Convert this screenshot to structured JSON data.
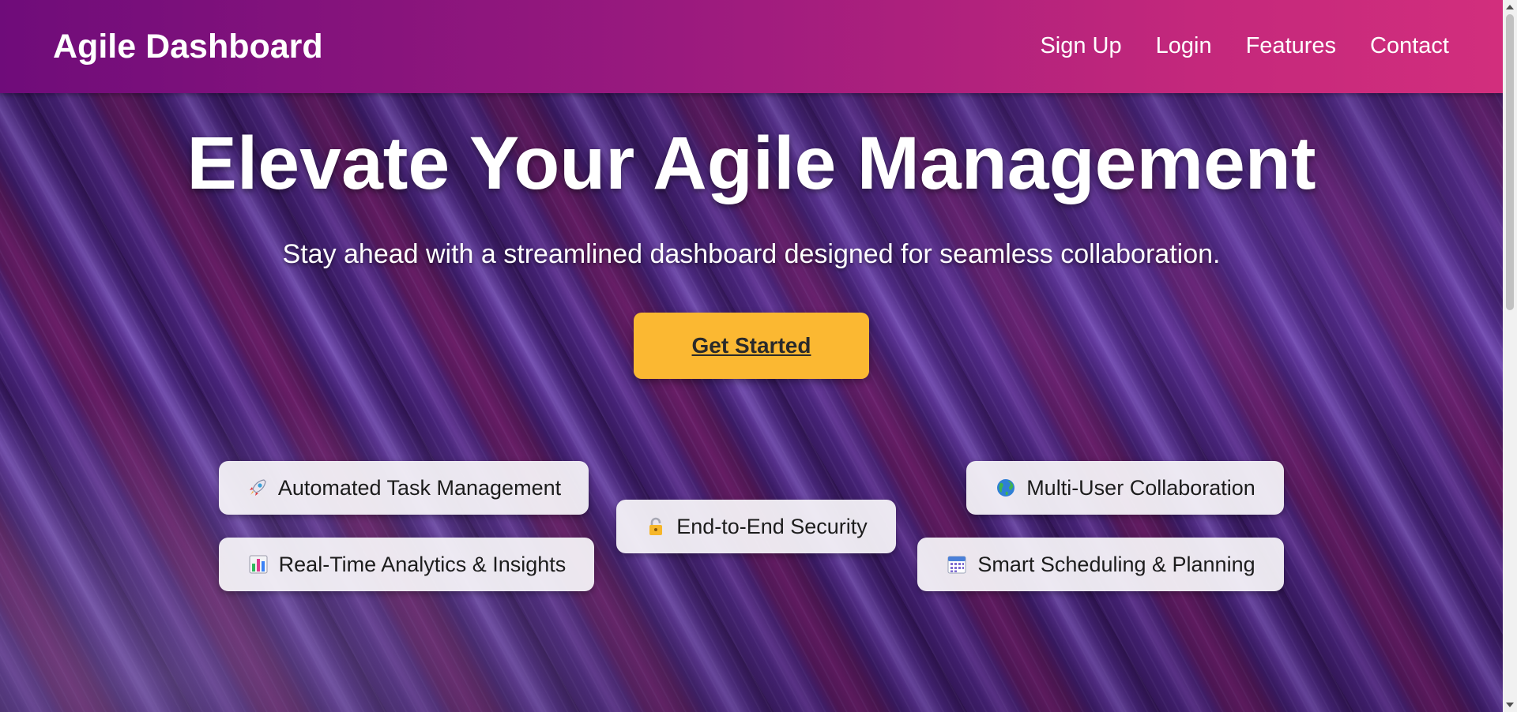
{
  "header": {
    "brand": "Agile Dashboard",
    "nav": [
      "Sign Up",
      "Login",
      "Features",
      "Contact"
    ],
    "gradient": [
      "#6f0c7a",
      "#d22e7d"
    ]
  },
  "hero": {
    "title": "Elevate Your Agile Management",
    "subtitle": "Stay ahead with a streamlined dashboard designed for seamless collaboration.",
    "cta_label": "Get Started",
    "cta_color": "#fbb832"
  },
  "features": [
    {
      "icon": "rocket-icon",
      "label": "Automated Task Management"
    },
    {
      "icon": "bar-chart-icon",
      "label": "Real-Time Analytics & Insights"
    },
    {
      "icon": "lock-icon",
      "label": "End-to-End Security"
    },
    {
      "icon": "globe-icon",
      "label": "Multi-User Collaboration"
    },
    {
      "icon": "calendar-icon",
      "label": "Smart Scheduling & Planning"
    }
  ]
}
